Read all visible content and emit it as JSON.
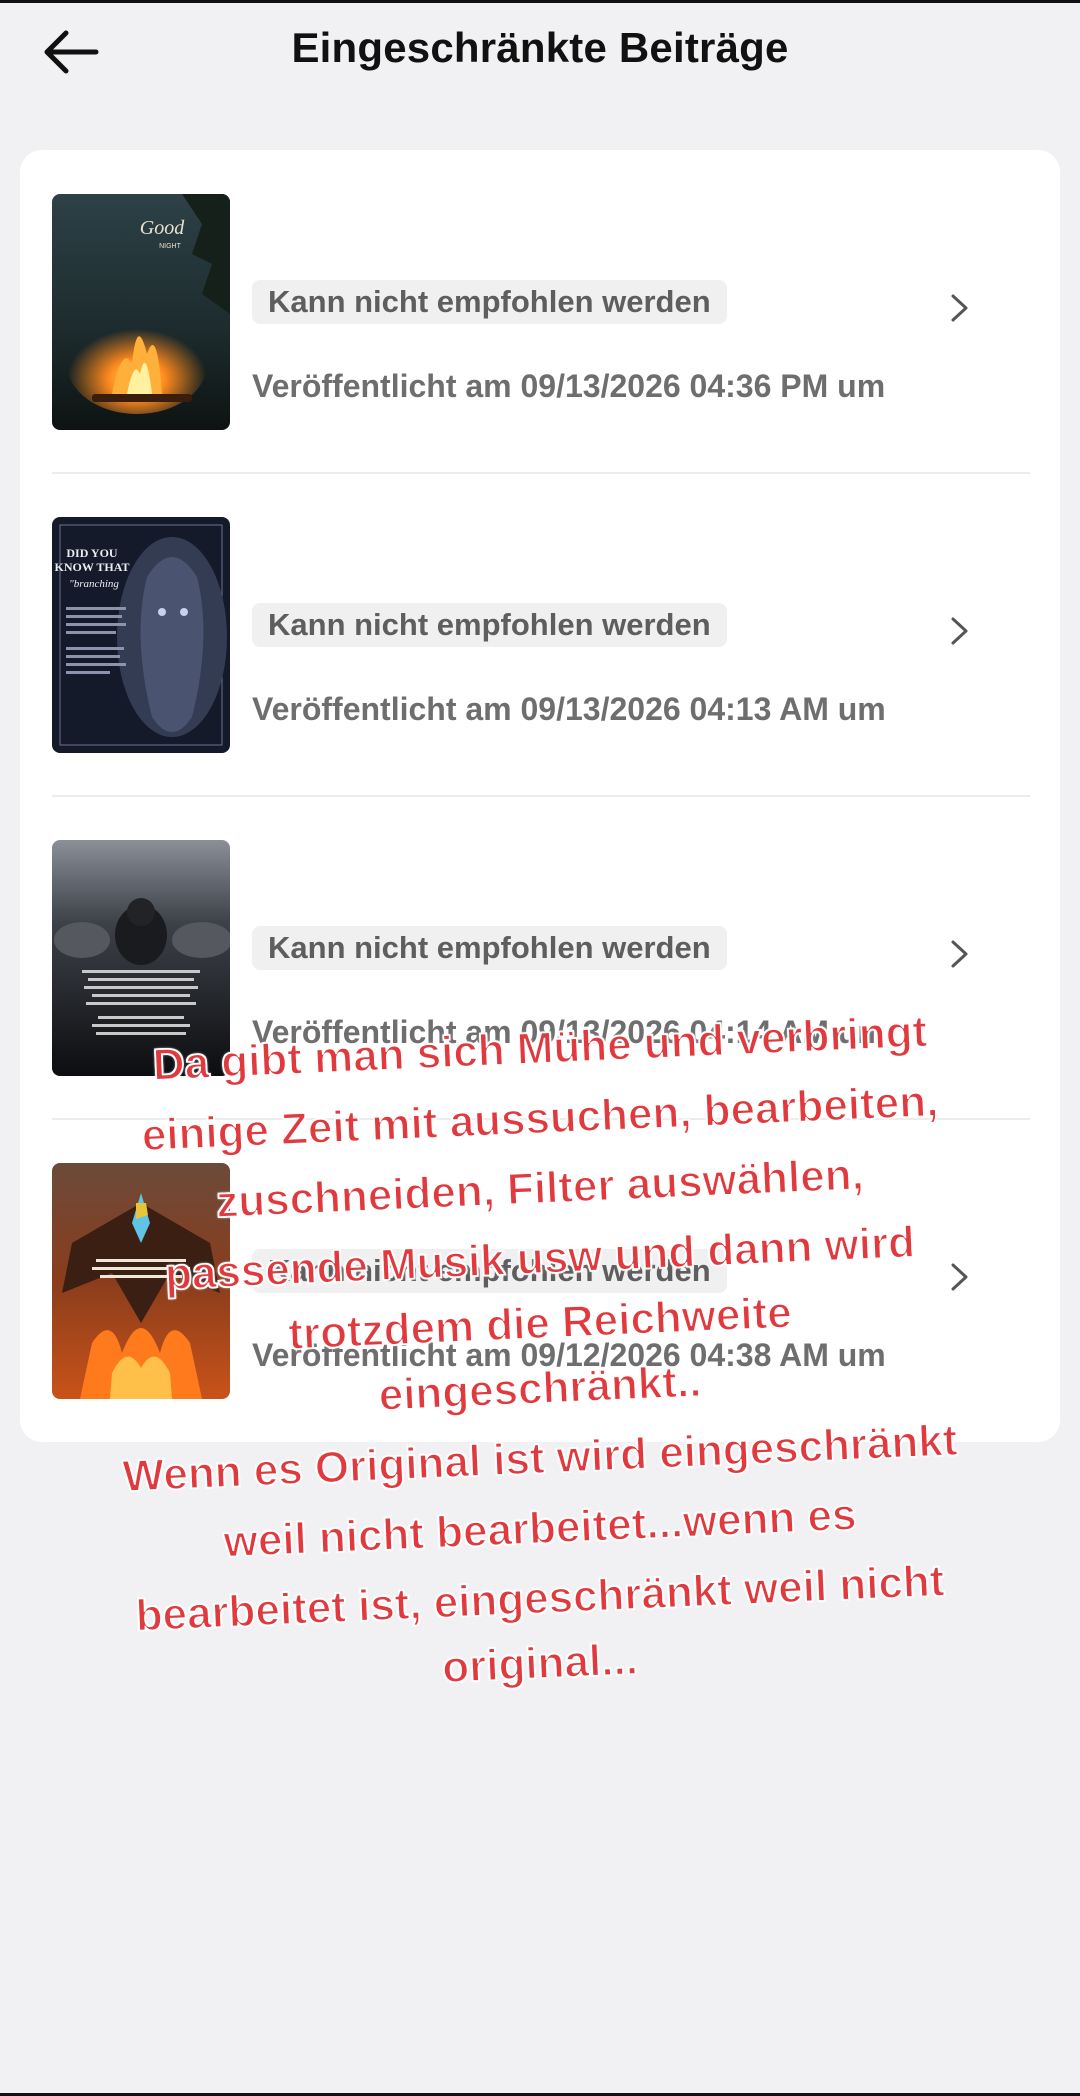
{
  "header": {
    "title": "Eingeschränkte Beiträge",
    "back_icon": "arrow-left-icon"
  },
  "posts": [
    {
      "status": "Kann nicht empfohlen werden",
      "published": "Veröffentlicht am 09/13/2026 04:36 PM um",
      "thumbnail": "campfire-good-night-image",
      "thumb_text": "Good NIGHT"
    },
    {
      "status": "Kann nicht empfohlen werden",
      "published": "Veröffentlicht am 09/13/2026 04:13 AM um",
      "thumbnail": "tree-spirit-quote-image",
      "thumb_text": "DID YOU KNOW THAT"
    },
    {
      "status": "Kann nicht empfohlen werden",
      "published": "Veröffentlicht am 09/13/2026 04:14 AM um",
      "thumbnail": "black-sheep-quote-image",
      "thumb_text": ""
    },
    {
      "status": "Kann nicht empfohlen werden",
      "published": "Veröffentlicht am 09/12/2026 04:38 AM um",
      "thumbnail": "phoenix-quote-image",
      "thumb_text": ""
    }
  ],
  "overlay": {
    "lines": [
      "Da gibt man sich Mühe und verbringt",
      "einige Zeit mit aussuchen, bearbeiten,",
      "zuschneiden, Filter auswählen,",
      "passende Musik usw und dann wird",
      "trotzdem die Reichweite",
      "eingeschränkt..",
      "Wenn es Original ist wird eingeschränkt",
      "weil nicht bearbeitet...wenn es",
      "bearbeitet ist, eingeschränkt weil nicht",
      "original..."
    ],
    "color": "#e03a3f"
  },
  "colors": {
    "background": "#f1f1f3",
    "card": "#ffffff",
    "badge_bg": "#f0f0f0",
    "badge_text": "#5e5e5e",
    "date_text": "#6e6e6e"
  }
}
